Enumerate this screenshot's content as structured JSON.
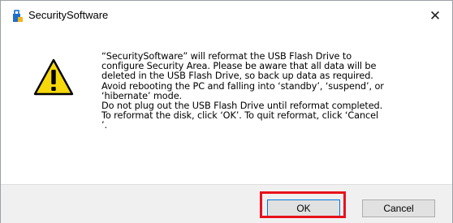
{
  "window": {
    "title": "SecuritySoftware",
    "close_glyph": "✕",
    "app_icon": "security-app-icon"
  },
  "message": {
    "icon": "warning-icon",
    "lines": [
      "“SecuritySoftware” will reformat the USB Flash Drive to",
      "configure Security Area. Please be aware that all data will be",
      "deleted in the USB Flash Drive, so back up data as required.",
      "Avoid rebooting the PC and falling into ‘standby’, ‘suspend’, or",
      "‘hibernate’ mode.",
      "Do not plug out the USB Flash Drive until reformat completed.",
      "To reformat the disk, click ‘OK’. To quit reformat, click ‘Cancel",
      "’."
    ]
  },
  "buttons": {
    "ok_label": "OK",
    "cancel_label": "Cancel"
  },
  "colors": {
    "highlight": "#e8111b",
    "warning_fill": "#f6d80b",
    "ok_border": "#0078d7"
  }
}
